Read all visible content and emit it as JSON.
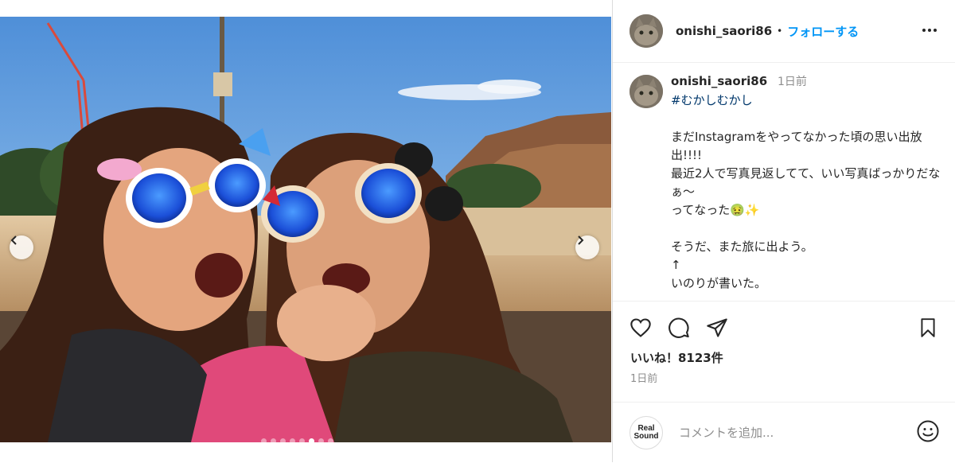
{
  "post": {
    "username": "onishi_saori86",
    "separator": "•",
    "follow_label": "フォローする",
    "more_label": "more-options",
    "media": {
      "carousel_dots": 8,
      "active_dot": 6
    }
  },
  "caption": {
    "username": "onishi_saori86",
    "time": "1日前",
    "hashtag": "#むかしむかし",
    "lines": [
      "まだInstagramをやってなかった頃の思い出放出!!!!",
      "最近2人で写真見返してて、いい写真ばっかりだなぁ〜",
      "ってなった🤢✨",
      "",
      "そうだ、また旅に出よう。",
      "↑",
      "いのりが書いた。"
    ]
  },
  "actions": {
    "like_icon": "heart-icon",
    "comment_icon": "comment-icon",
    "share_icon": "paper-plane-icon",
    "save_icon": "bookmark-icon",
    "likes_text": "いいね！8123件",
    "time_text": "1日前"
  },
  "comment": {
    "badge_line1": "Real",
    "badge_line2": "Sound",
    "placeholder": "コメントを追加...",
    "emoji_icon": "smiley-icon"
  },
  "colors": {
    "follow": "#0095f6",
    "hashtag": "#00376b",
    "muted": "#8e8e8e"
  }
}
